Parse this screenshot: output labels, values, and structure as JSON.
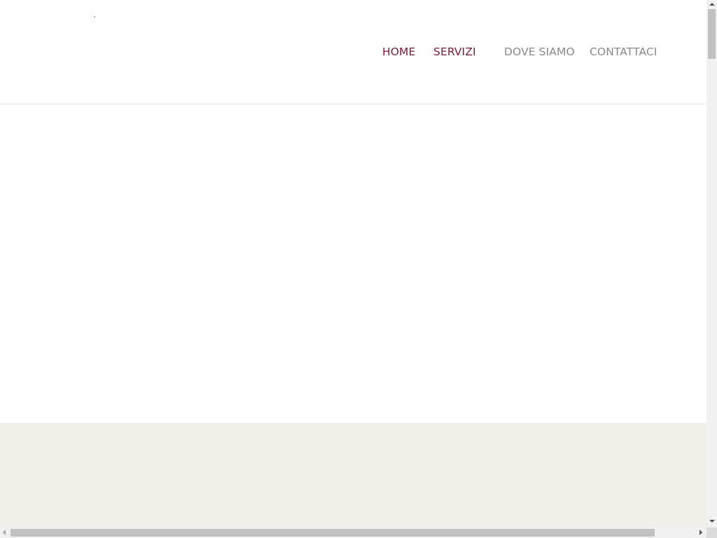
{
  "nav": {
    "items": [
      {
        "label": "HOME",
        "color": "#7d1a3c"
      },
      {
        "label": "SERVIZI",
        "color": "#7d1a3c"
      },
      {
        "label": "DOVE SIAMO",
        "color": "#8a8a8a"
      },
      {
        "label": "CONTATTACI",
        "color": "#8a8a8a"
      }
    ]
  },
  "colors": {
    "accent": "#7d1a3c",
    "nav_inactive": "#8a8a8a",
    "footer_band": "#f2efeb",
    "header_border": "#e6e6e6"
  },
  "scrollbars": {
    "vertical": "scrollbar-vertical",
    "horizontal": "scrollbar-horizontal"
  }
}
